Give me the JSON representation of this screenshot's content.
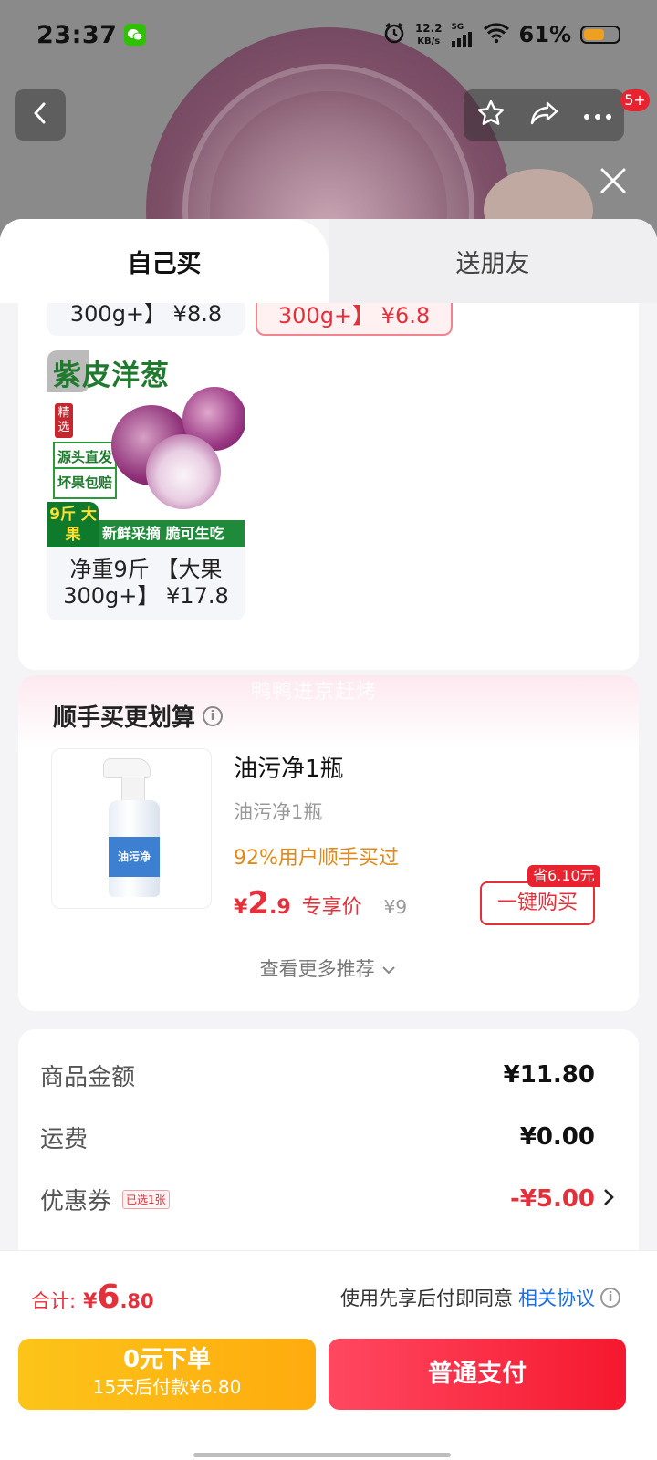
{
  "status_bar": {
    "time": "23:37",
    "net_speed_value": "12.2",
    "net_speed_unit": "KB/s",
    "signal_label": "5G",
    "battery_percent_text": "61%",
    "battery_level": 0.61
  },
  "nav": {
    "badge": "5+"
  },
  "tabs": [
    {
      "label": "自己买",
      "active": true
    },
    {
      "label": "送朋友",
      "active": false
    }
  ],
  "sku": {
    "options": [
      {
        "label": "300g+】 ¥8.8",
        "selected": false
      },
      {
        "label": "300g+】 ¥6.8",
        "selected": true
      },
      {
        "line1": "净重9斤 【大果",
        "line2": "300g+】 ¥17.8",
        "selected": false
      }
    ],
    "image_text": {
      "title": "紫皮洋葱",
      "tag_select": "精选",
      "tag_source": "源头直发",
      "tag_guarantee": "坏果包赔",
      "badge": "9斤 大果",
      "band": "新鲜采摘 脆可生吃"
    }
  },
  "combo": {
    "title": "顺手买更划算",
    "watermark": "鸭鸭进京赶烤",
    "product_name": "油污净1瓶",
    "product_spec": "油污净1瓶",
    "social_proof": "92%用户顺手买过",
    "price_currency": "¥",
    "price_int": "2",
    "price_dec": ".9",
    "price_tag": "专享价",
    "orig_price": "¥9",
    "save_badge": "省6.10元",
    "buy_button": "一键购买",
    "more": "查看更多推荐",
    "bottle_label": "油污净"
  },
  "breakdown": {
    "rows": [
      {
        "label": "商品金额",
        "value": "¥11.80"
      },
      {
        "label": "运费",
        "value": "¥0.00"
      },
      {
        "label": "优惠券",
        "value": "-¥5.00",
        "chip": "已选1张"
      }
    ]
  },
  "bottom": {
    "total_label": "合计:",
    "total_currency": "¥",
    "total_int": "6",
    "total_dec": ".80",
    "agree_text": "使用先享后付即同意",
    "agree_link": "相关协议",
    "later_line1": "0元下单",
    "later_line2": "15天后付款¥6.80",
    "pay_label": "普通支付"
  },
  "colors": {
    "accent_red": "#e5303b",
    "pay_gradient": "#ff4861",
    "later_gradient": "#fcc419",
    "link_blue": "#1f6fe0",
    "social_orange": "#e08a1a"
  },
  "icons": [
    "wechat-icon",
    "alarm-icon",
    "signal-icon",
    "wifi-icon",
    "battery-icon",
    "back-arrow-icon",
    "star-icon",
    "share-icon",
    "more-dots-icon",
    "close-icon",
    "info-icon",
    "chevron-down-icon",
    "chevron-right-icon"
  ]
}
